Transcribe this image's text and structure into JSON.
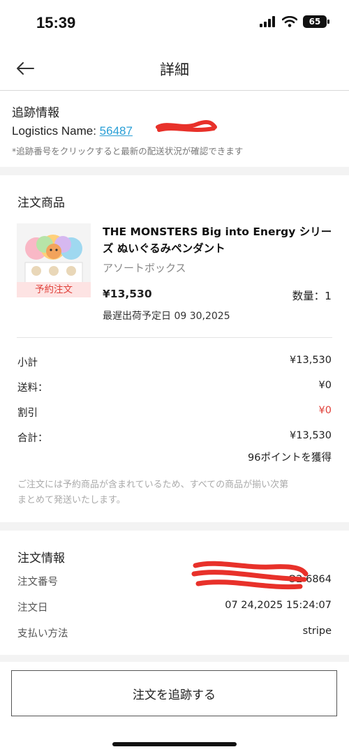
{
  "status": {
    "time": "15:39",
    "battery": "65"
  },
  "nav": {
    "title": "詳細"
  },
  "tracking": {
    "title": "追跡情報",
    "logistics_label": "Logistics Name:",
    "tracking_number": "56487",
    "note": "*追跡番号をクリックすると最新の配送状況が確認できます"
  },
  "order_items": {
    "title": "注文商品",
    "product": {
      "name": "THE MONSTERS Big into Energy シリーズ ぬいぐるみペンダント",
      "variant": "アソートボックス",
      "badge": "予約注文",
      "price": "¥13,530",
      "qty_label": "数量：",
      "qty": "1",
      "ship_label": "最遅出荷予定日",
      "ship_date": "09 30,2025"
    },
    "summary": [
      {
        "label": "小計",
        "value": "¥13,530"
      },
      {
        "label": "送料：",
        "value": "¥0"
      },
      {
        "label": "割引",
        "value": "¥0"
      },
      {
        "label": "合計：",
        "value": "¥13,530"
      }
    ],
    "points": "96ポイントを獲得",
    "notice_line1": "ご注文には予約商品が含まれているため、すべての商品が揃い次第",
    "notice_line2": "まとめて発送いたします。"
  },
  "order_info": {
    "title": "注文情報",
    "rows": [
      {
        "label": "注文番号",
        "value": "O2  6864"
      },
      {
        "label": "注文日",
        "value": "07 24,2025 15:24:07"
      },
      {
        "label": "支払い方法",
        "value": "stripe"
      }
    ]
  },
  "actions": {
    "track_order": "注文を追跡する"
  },
  "colors": {
    "link": "#2a9fd6",
    "discount": "#e0413a",
    "badge": "#e0413a",
    "redaction": "#e8312a"
  }
}
